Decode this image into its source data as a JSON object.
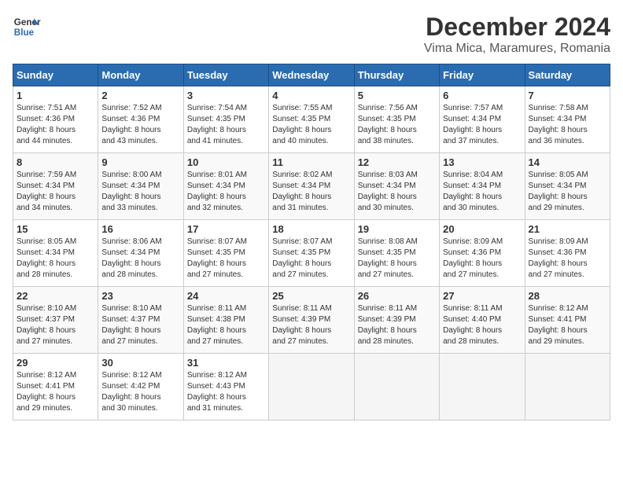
{
  "header": {
    "logo_line1": "General",
    "logo_line2": "Blue",
    "title": "December 2024",
    "subtitle": "Vima Mica, Maramures, Romania"
  },
  "calendar": {
    "days_of_week": [
      "Sunday",
      "Monday",
      "Tuesday",
      "Wednesday",
      "Thursday",
      "Friday",
      "Saturday"
    ],
    "weeks": [
      [
        {
          "day": "1",
          "sunrise": "Sunrise: 7:51 AM",
          "sunset": "Sunset: 4:36 PM",
          "daylight": "Daylight: 8 hours",
          "daylight2": "and 44 minutes."
        },
        {
          "day": "2",
          "sunrise": "Sunrise: 7:52 AM",
          "sunset": "Sunset: 4:36 PM",
          "daylight": "Daylight: 8 hours",
          "daylight2": "and 43 minutes."
        },
        {
          "day": "3",
          "sunrise": "Sunrise: 7:54 AM",
          "sunset": "Sunset: 4:35 PM",
          "daylight": "Daylight: 8 hours",
          "daylight2": "and 41 minutes."
        },
        {
          "day": "4",
          "sunrise": "Sunrise: 7:55 AM",
          "sunset": "Sunset: 4:35 PM",
          "daylight": "Daylight: 8 hours",
          "daylight2": "and 40 minutes."
        },
        {
          "day": "5",
          "sunrise": "Sunrise: 7:56 AM",
          "sunset": "Sunset: 4:35 PM",
          "daylight": "Daylight: 8 hours",
          "daylight2": "and 38 minutes."
        },
        {
          "day": "6",
          "sunrise": "Sunrise: 7:57 AM",
          "sunset": "Sunset: 4:34 PM",
          "daylight": "Daylight: 8 hours",
          "daylight2": "and 37 minutes."
        },
        {
          "day": "7",
          "sunrise": "Sunrise: 7:58 AM",
          "sunset": "Sunset: 4:34 PM",
          "daylight": "Daylight: 8 hours",
          "daylight2": "and 36 minutes."
        }
      ],
      [
        {
          "day": "8",
          "sunrise": "Sunrise: 7:59 AM",
          "sunset": "Sunset: 4:34 PM",
          "daylight": "Daylight: 8 hours",
          "daylight2": "and 34 minutes."
        },
        {
          "day": "9",
          "sunrise": "Sunrise: 8:00 AM",
          "sunset": "Sunset: 4:34 PM",
          "daylight": "Daylight: 8 hours",
          "daylight2": "and 33 minutes."
        },
        {
          "day": "10",
          "sunrise": "Sunrise: 8:01 AM",
          "sunset": "Sunset: 4:34 PM",
          "daylight": "Daylight: 8 hours",
          "daylight2": "and 32 minutes."
        },
        {
          "day": "11",
          "sunrise": "Sunrise: 8:02 AM",
          "sunset": "Sunset: 4:34 PM",
          "daylight": "Daylight: 8 hours",
          "daylight2": "and 31 minutes."
        },
        {
          "day": "12",
          "sunrise": "Sunrise: 8:03 AM",
          "sunset": "Sunset: 4:34 PM",
          "daylight": "Daylight: 8 hours",
          "daylight2": "and 30 minutes."
        },
        {
          "day": "13",
          "sunrise": "Sunrise: 8:04 AM",
          "sunset": "Sunset: 4:34 PM",
          "daylight": "Daylight: 8 hours",
          "daylight2": "and 30 minutes."
        },
        {
          "day": "14",
          "sunrise": "Sunrise: 8:05 AM",
          "sunset": "Sunset: 4:34 PM",
          "daylight": "Daylight: 8 hours",
          "daylight2": "and 29 minutes."
        }
      ],
      [
        {
          "day": "15",
          "sunrise": "Sunrise: 8:05 AM",
          "sunset": "Sunset: 4:34 PM",
          "daylight": "Daylight: 8 hours",
          "daylight2": "and 28 minutes."
        },
        {
          "day": "16",
          "sunrise": "Sunrise: 8:06 AM",
          "sunset": "Sunset: 4:34 PM",
          "daylight": "Daylight: 8 hours",
          "daylight2": "and 28 minutes."
        },
        {
          "day": "17",
          "sunrise": "Sunrise: 8:07 AM",
          "sunset": "Sunset: 4:35 PM",
          "daylight": "Daylight: 8 hours",
          "daylight2": "and 27 minutes."
        },
        {
          "day": "18",
          "sunrise": "Sunrise: 8:07 AM",
          "sunset": "Sunset: 4:35 PM",
          "daylight": "Daylight: 8 hours",
          "daylight2": "and 27 minutes."
        },
        {
          "day": "19",
          "sunrise": "Sunrise: 8:08 AM",
          "sunset": "Sunset: 4:35 PM",
          "daylight": "Daylight: 8 hours",
          "daylight2": "and 27 minutes."
        },
        {
          "day": "20",
          "sunrise": "Sunrise: 8:09 AM",
          "sunset": "Sunset: 4:36 PM",
          "daylight": "Daylight: 8 hours",
          "daylight2": "and 27 minutes."
        },
        {
          "day": "21",
          "sunrise": "Sunrise: 8:09 AM",
          "sunset": "Sunset: 4:36 PM",
          "daylight": "Daylight: 8 hours",
          "daylight2": "and 27 minutes."
        }
      ],
      [
        {
          "day": "22",
          "sunrise": "Sunrise: 8:10 AM",
          "sunset": "Sunset: 4:37 PM",
          "daylight": "Daylight: 8 hours",
          "daylight2": "and 27 minutes."
        },
        {
          "day": "23",
          "sunrise": "Sunrise: 8:10 AM",
          "sunset": "Sunset: 4:37 PM",
          "daylight": "Daylight: 8 hours",
          "daylight2": "and 27 minutes."
        },
        {
          "day": "24",
          "sunrise": "Sunrise: 8:11 AM",
          "sunset": "Sunset: 4:38 PM",
          "daylight": "Daylight: 8 hours",
          "daylight2": "and 27 minutes."
        },
        {
          "day": "25",
          "sunrise": "Sunrise: 8:11 AM",
          "sunset": "Sunset: 4:39 PM",
          "daylight": "Daylight: 8 hours",
          "daylight2": "and 27 minutes."
        },
        {
          "day": "26",
          "sunrise": "Sunrise: 8:11 AM",
          "sunset": "Sunset: 4:39 PM",
          "daylight": "Daylight: 8 hours",
          "daylight2": "and 28 minutes."
        },
        {
          "day": "27",
          "sunrise": "Sunrise: 8:11 AM",
          "sunset": "Sunset: 4:40 PM",
          "daylight": "Daylight: 8 hours",
          "daylight2": "and 28 minutes."
        },
        {
          "day": "28",
          "sunrise": "Sunrise: 8:12 AM",
          "sunset": "Sunset: 4:41 PM",
          "daylight": "Daylight: 8 hours",
          "daylight2": "and 29 minutes."
        }
      ],
      [
        {
          "day": "29",
          "sunrise": "Sunrise: 8:12 AM",
          "sunset": "Sunset: 4:41 PM",
          "daylight": "Daylight: 8 hours",
          "daylight2": "and 29 minutes."
        },
        {
          "day": "30",
          "sunrise": "Sunrise: 8:12 AM",
          "sunset": "Sunset: 4:42 PM",
          "daylight": "Daylight: 8 hours",
          "daylight2": "and 30 minutes."
        },
        {
          "day": "31",
          "sunrise": "Sunrise: 8:12 AM",
          "sunset": "Sunset: 4:43 PM",
          "daylight": "Daylight: 8 hours",
          "daylight2": "and 31 minutes."
        },
        null,
        null,
        null,
        null
      ]
    ]
  }
}
